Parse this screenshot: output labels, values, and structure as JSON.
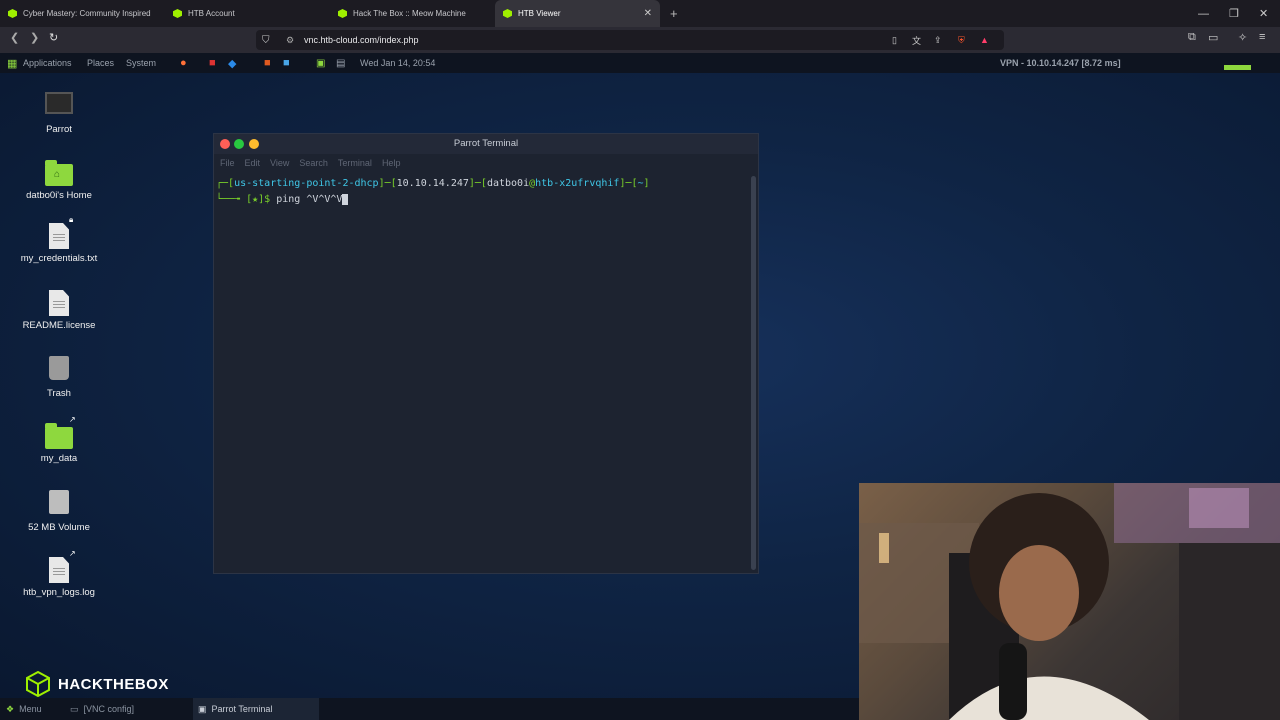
{
  "browser": {
    "tabs": [
      {
        "label": "Cyber Mastery: Community Inspired",
        "active": false
      },
      {
        "label": "HTB Account",
        "active": false
      },
      {
        "label": "Hack The Box :: Meow Machine",
        "active": false
      },
      {
        "label": "HTB Viewer",
        "active": true
      }
    ],
    "url": "vnc.htb-cloud.com/index.php"
  },
  "panel": {
    "menus": [
      "Applications",
      "Places",
      "System"
    ],
    "datetime": "Wed Jan 14, 20:54",
    "vpn": "VPN - 10.10.14.247 [8.72 ms]"
  },
  "desktop": {
    "icons": [
      {
        "label": "Parrot",
        "icon": "monitor-icon"
      },
      {
        "label": "datbo0i's Home",
        "icon": "home-folder-icon"
      },
      {
        "label": "my_credentials.txt",
        "icon": "text-file-icon"
      },
      {
        "label": "README.license",
        "icon": "text-file-icon"
      },
      {
        "label": "Trash",
        "icon": "trash-icon"
      },
      {
        "label": "my_data",
        "icon": "folder-icon"
      },
      {
        "label": "52 MB Volume",
        "icon": "drive-icon"
      },
      {
        "label": "htb_vpn_logs.log",
        "icon": "text-file-icon"
      }
    ]
  },
  "terminal": {
    "title": "Parrot Terminal",
    "menu": [
      "File",
      "Edit",
      "View",
      "Search",
      "Terminal",
      "Help"
    ],
    "prompt": {
      "corner": "┌─",
      "host_tag": "us-starting-point-2-dhcp",
      "ip": "10.10.14.247",
      "user": "datbo0i",
      "at": "@",
      "machine": "htb-x2ufrvqhif",
      "dir": "~",
      "line2": "└──╼ ",
      "marker": "[★]$ ",
      "command": "ping ^V^V^V"
    }
  },
  "branding": {
    "logo_text": "HACKTHEBOX"
  },
  "taskbar": {
    "menu": "Menu",
    "items": [
      "[VNC config]",
      "Parrot Terminal"
    ]
  },
  "colors": {
    "accent": "#9fef00",
    "prompt_green": "#7ad02a",
    "prompt_cyan": "#3fc6e6"
  }
}
